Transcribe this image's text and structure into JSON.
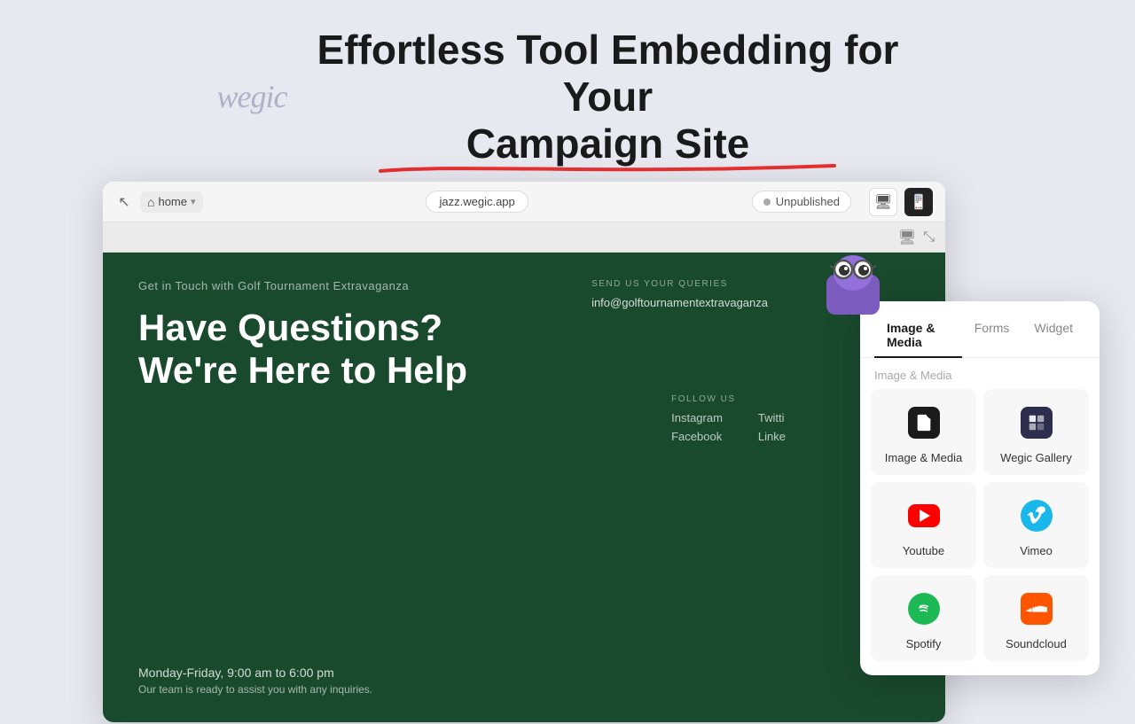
{
  "page": {
    "background_color": "#e8e8f0"
  },
  "header": {
    "logo": "wegic",
    "heading_line1": "Effortless Tool Embedding for Your",
    "heading_line2": "Campaign Site"
  },
  "browser": {
    "nav": {
      "back_icon": "↖",
      "home_label": "home",
      "chevron": "▾",
      "url": "jazz.wegic.app",
      "status": "Unpublished",
      "desktop_icon": "⬜",
      "mobile_icon": "📱"
    },
    "site": {
      "subtitle": "Get in Touch with Golf Tournament Extravaganza",
      "heading": "Have Questions? We're Here to Help",
      "contact_label": "SEND US YOUR QUERIES",
      "email": "info@golftournamentextravaganza",
      "follow_label": "FOLLOW US",
      "socials": [
        "Instagram",
        "Twitter",
        "Facebook",
        "Linke"
      ],
      "hours": "Monday-Friday, 9:00 am to 6:00 pm",
      "hours_desc": "Our team is ready to assist you with any inquiries."
    }
  },
  "panel": {
    "tabs": [
      {
        "label": "Image & Media",
        "active": true
      },
      {
        "label": "Forms",
        "active": false
      },
      {
        "label": "Widget",
        "active": false
      }
    ],
    "section_label": "Image & Media",
    "cards": [
      {
        "id": "image-media",
        "label": "Image & Media",
        "icon_type": "img-media"
      },
      {
        "id": "wegic-gallery",
        "label": "Wegic Gallery",
        "icon_type": "wegic-gallery"
      },
      {
        "id": "youtube",
        "label": "Youtube",
        "icon_type": "youtube"
      },
      {
        "id": "vimeo",
        "label": "Vimeo",
        "icon_type": "vimeo"
      },
      {
        "id": "spotify",
        "label": "Spotify",
        "icon_type": "spotify"
      },
      {
        "id": "soundcloud",
        "label": "Soundcloud",
        "icon_type": "soundcloud"
      }
    ]
  }
}
